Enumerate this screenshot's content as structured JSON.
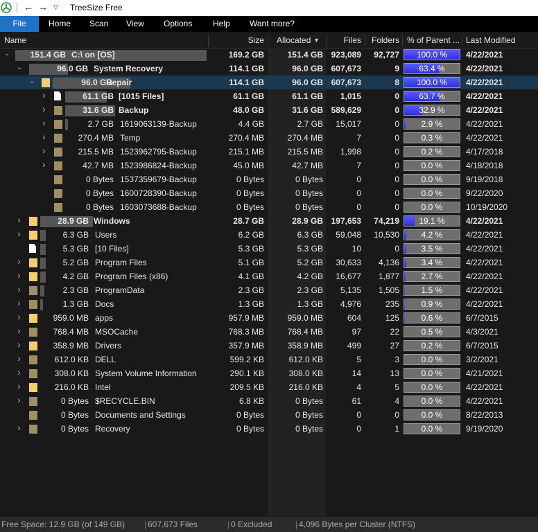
{
  "window": {
    "title": "TreeSize Free"
  },
  "menu": [
    "File",
    "Home",
    "Scan",
    "View",
    "Options",
    "Help",
    "Want more?"
  ],
  "columns": [
    "Name",
    "Size",
    "Allocated",
    "Files",
    "Folders",
    "% of Parent ...",
    "Last Modified"
  ],
  "rows": [
    {
      "expander": "expanded",
      "icon": "yellow",
      "name": "C:\\  on  [OS]",
      "size": "151.4 GB",
      "total": "169.2 GB",
      "alloc": "151.4 GB",
      "files": "923,089",
      "folders": "92,727",
      "pct": 100.0,
      "pct_text": "100.0 %",
      "date": "4/22/2021",
      "bold": true
    },
    {
      "expander": "expanded",
      "icon": "dim",
      "name": "System Recovery",
      "size": "96.0 GB",
      "total": "114.1 GB",
      "alloc": "96.0 GB",
      "files": "607,673",
      "folders": "9",
      "pct": 63.4,
      "pct_text": "63.4 %",
      "date": "4/22/2021",
      "bold": true
    },
    {
      "expander": "expanded",
      "icon": "yellow",
      "name": "Repair",
      "size": "96.0 GB",
      "total": "114.1 GB",
      "alloc": "96.0 GB",
      "files": "607,673",
      "folders": "8",
      "pct": 100.0,
      "pct_text": "100.0 %",
      "date": "4/22/2021",
      "bold": true,
      "selected": true
    },
    {
      "expander": "collapsed",
      "icon": "file",
      "name": "[1015 Files]",
      "size": "61.1 GB",
      "total": "61.1 GB",
      "alloc": "61.1 GB",
      "files": "1,015",
      "folders": "0",
      "pct": 63.7,
      "pct_text": "63.7 %",
      "date": "4/22/2021",
      "bold": true
    },
    {
      "expander": "collapsed",
      "icon": "dim",
      "name": "Backup",
      "size": "31.6 GB",
      "total": "48.0 GB",
      "alloc": "31.6 GB",
      "files": "589,629",
      "folders": "0",
      "pct": 32.9,
      "pct_text": "32.9 %",
      "date": "4/22/2021",
      "bold": true
    },
    {
      "expander": "collapsed",
      "icon": "dim",
      "name": "1619063139-Backup",
      "size": "2.7 GB",
      "total": "4.4 GB",
      "alloc": "2.7 GB",
      "files": "15,017",
      "folders": "0",
      "pct": 2.9,
      "pct_text": "2.9 %",
      "date": "4/22/2021",
      "bold": false
    },
    {
      "expander": "collapsed",
      "icon": "dim",
      "name": "Temp",
      "size": "270.4 MB",
      "total": "270.4 MB",
      "alloc": "270.4 MB",
      "files": "7",
      "folders": "0",
      "pct": 0.3,
      "pct_text": "0.3 %",
      "date": "4/22/2021",
      "bold": false
    },
    {
      "expander": "collapsed",
      "icon": "dim",
      "name": "1523962795-Backup",
      "size": "215.5 MB",
      "total": "215.1 MB",
      "alloc": "215.5 MB",
      "files": "1,998",
      "folders": "0",
      "pct": 0.2,
      "pct_text": "0.2 %",
      "date": "4/17/2018",
      "bold": false
    },
    {
      "expander": "collapsed",
      "icon": "dim",
      "name": "1523986824-Backup",
      "size": "42.7 MB",
      "total": "45.0 MB",
      "alloc": "42.7 MB",
      "files": "7",
      "folders": "0",
      "pct": 0.0,
      "pct_text": "0.0 %",
      "date": "4/18/2018",
      "bold": false
    },
    {
      "expander": "none",
      "icon": "dim",
      "name": "1537359679-Backup",
      "size": "0 Bytes",
      "total": "0 Bytes",
      "alloc": "0 Bytes",
      "files": "0",
      "folders": "0",
      "pct": 0.0,
      "pct_text": "0.0 %",
      "date": "9/19/2018",
      "bold": false
    },
    {
      "expander": "none",
      "icon": "dim",
      "name": "1600728390-Backup",
      "size": "0 Bytes",
      "total": "0 Bytes",
      "alloc": "0 Bytes",
      "files": "0",
      "folders": "0",
      "pct": 0.0,
      "pct_text": "0.0 %",
      "date": "9/22/2020",
      "bold": false
    },
    {
      "expander": "none",
      "icon": "dim",
      "name": "1603073688-Backup",
      "size": "0 Bytes",
      "total": "0 Bytes",
      "alloc": "0 Bytes",
      "files": "0",
      "folders": "0",
      "pct": 0.0,
      "pct_text": "0.0 %",
      "date": "10/19/2020",
      "bold": false
    },
    {
      "expander": "collapsed",
      "icon": "yellow",
      "name": "Windows",
      "size": "28.9 GB",
      "total": "28.7 GB",
      "alloc": "28.9 GB",
      "files": "197,653",
      "folders": "74,219",
      "pct": 19.1,
      "pct_text": "19.1 %",
      "date": "4/22/2021",
      "bold": true
    },
    {
      "expander": "collapsed",
      "icon": "yellow",
      "name": "Users",
      "size": "6.3 GB",
      "total": "6.2 GB",
      "alloc": "6.3 GB",
      "files": "59,048",
      "folders": "10,530",
      "pct": 4.2,
      "pct_text": "4.2 %",
      "date": "4/22/2021",
      "bold": false
    },
    {
      "expander": "none",
      "icon": "file",
      "name": "[10 Files]",
      "size": "5.3 GB",
      "total": "5.3 GB",
      "alloc": "5.3 GB",
      "files": "10",
      "folders": "0",
      "pct": 3.5,
      "pct_text": "3.5 %",
      "date": "4/22/2021",
      "bold": false
    },
    {
      "expander": "collapsed",
      "icon": "yellow",
      "name": "Program Files",
      "size": "5.2 GB",
      "total": "5.1 GB",
      "alloc": "5.2 GB",
      "files": "30,633",
      "folders": "4,136",
      "pct": 3.4,
      "pct_text": "3.4 %",
      "date": "4/22/2021",
      "bold": false
    },
    {
      "expander": "collapsed",
      "icon": "yellow",
      "name": "Program Files (x86)",
      "size": "4.2 GB",
      "total": "4.1 GB",
      "alloc": "4.2 GB",
      "files": "16,677",
      "folders": "1,877",
      "pct": 2.7,
      "pct_text": "2.7 %",
      "date": "4/22/2021",
      "bold": false
    },
    {
      "expander": "collapsed",
      "icon": "dim",
      "name": "ProgramData",
      "size": "2.3 GB",
      "total": "2.3 GB",
      "alloc": "2.3 GB",
      "files": "5,135",
      "folders": "1,505",
      "pct": 1.5,
      "pct_text": "1.5 %",
      "date": "4/22/2021",
      "bold": false
    },
    {
      "expander": "collapsed",
      "icon": "dim",
      "name": "Docs",
      "size": "1.3 GB",
      "total": "1.3 GB",
      "alloc": "1.3 GB",
      "files": "4,976",
      "folders": "235",
      "pct": 0.9,
      "pct_text": "0.9 %",
      "date": "4/22/2021",
      "bold": false
    },
    {
      "expander": "collapsed",
      "icon": "yellow",
      "name": "apps",
      "size": "959.0 MB",
      "total": "957.9 MB",
      "alloc": "959.0 MB",
      "files": "604",
      "folders": "125",
      "pct": 0.6,
      "pct_text": "0.6 %",
      "date": "6/7/2015",
      "bold": false
    },
    {
      "expander": "collapsed",
      "icon": "dim",
      "name": "MSOCache",
      "size": "768.4 MB",
      "total": "768.3 MB",
      "alloc": "768.4 MB",
      "files": "97",
      "folders": "22",
      "pct": 0.5,
      "pct_text": "0.5 %",
      "date": "4/3/2021",
      "bold": false
    },
    {
      "expander": "collapsed",
      "icon": "yellow",
      "name": "Drivers",
      "size": "358.9 MB",
      "total": "357.9 MB",
      "alloc": "358.9 MB",
      "files": "499",
      "folders": "27",
      "pct": 0.2,
      "pct_text": "0.2 %",
      "date": "6/7/2015",
      "bold": false
    },
    {
      "expander": "collapsed",
      "icon": "dim",
      "name": "DELL",
      "size": "612.0 KB",
      "total": "599.2 KB",
      "alloc": "612.0 KB",
      "files": "5",
      "folders": "3",
      "pct": 0.0,
      "pct_text": "0.0 %",
      "date": "3/2/2021",
      "bold": false
    },
    {
      "expander": "collapsed",
      "icon": "dim",
      "name": "System Volume Information",
      "size": "308.0 KB",
      "total": "290.1 KB",
      "alloc": "308.0 KB",
      "files": "14",
      "folders": "13",
      "pct": 0.0,
      "pct_text": "0.0 %",
      "date": "4/21/2021",
      "bold": false
    },
    {
      "expander": "collapsed",
      "icon": "yellow",
      "name": "Intel",
      "size": "216.0 KB",
      "total": "209.5 KB",
      "alloc": "216.0 KB",
      "files": "4",
      "folders": "5",
      "pct": 0.0,
      "pct_text": "0.0 %",
      "date": "4/22/2021",
      "bold": false
    },
    {
      "expander": "collapsed",
      "icon": "dim",
      "name": "$RECYCLE.BIN",
      "size": "0 Bytes",
      "total": "6.8 KB",
      "alloc": "0 Bytes",
      "files": "61",
      "folders": "4",
      "pct": 0.0,
      "pct_text": "0.0 %",
      "date": "4/22/2021",
      "bold": false
    },
    {
      "expander": "none",
      "icon": "dim",
      "name": "Documents and Settings",
      "size": "0 Bytes",
      "total": "0 Bytes",
      "alloc": "0 Bytes",
      "files": "0",
      "folders": "0",
      "pct": 0.0,
      "pct_text": "0.0 %",
      "date": "8/22/2013",
      "bold": false
    },
    {
      "expander": "collapsed",
      "icon": "dim",
      "name": "Recovery",
      "size": "0 Bytes",
      "total": "0 Bytes",
      "alloc": "0 Bytes",
      "files": "0",
      "folders": "1",
      "pct": 0.0,
      "pct_text": "0.0 %",
      "date": "9/19/2020",
      "bold": false
    }
  ],
  "status": {
    "free_space": "Free Space: 12.9 GB  (of 149 GB)",
    "files": "607,673 Files",
    "excluded": "0 Excluded",
    "cluster": "4,096 Bytes per Cluster (NTFS)"
  }
}
